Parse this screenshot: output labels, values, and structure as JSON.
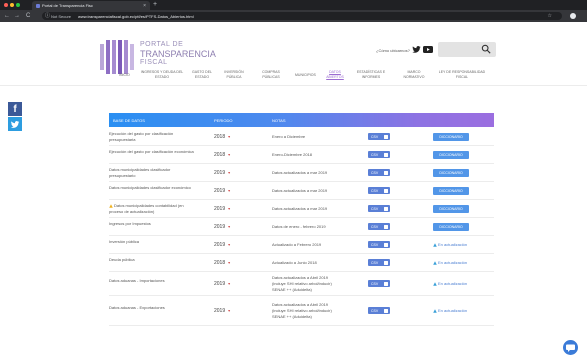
{
  "browser": {
    "tab_title": "Portal de Transparencia Fisc",
    "tab_close": "×",
    "new_tab": "+",
    "back": "←",
    "forward": "→",
    "reload": "C",
    "info": "ⓘ",
    "security": "Not Secure",
    "url": "www.transparenciafiscal.gob.ec/ptf/es/PTFS-Datos_Abiertos.html",
    "star": "☆",
    "dot_colors": [
      "#ff5f57",
      "#febc2e",
      "#28c840"
    ]
  },
  "site": {
    "logo": [
      "PORTAL DE",
      "TRANSPARENCIA",
      "FISCAL"
    ],
    "contact_question": "¿Cómo ubicarnos?",
    "brand_colors": {
      "purple": "#9b6ee0",
      "blue": "#2a8ff2"
    }
  },
  "nav": [
    {
      "label": "INICIO"
    },
    {
      "label": "INGRESOS Y DEUDA DEL ESTADO"
    },
    {
      "label": "GASTO DEL ESTADO"
    },
    {
      "label": "INVERSIÓN PÚBLICA"
    },
    {
      "label": "COMPRAS PÚBLICAS"
    },
    {
      "label": "MUNICIPIOS"
    },
    {
      "label": "DATOS ABIERTOS",
      "active": true
    },
    {
      "label": "ESTADÍSTICAS E INFORMES"
    },
    {
      "label": "MARCO NORMATIVO"
    },
    {
      "label": "LEY DE RESPONSABILIDAD FISCAL"
    }
  ],
  "table": {
    "headers": {
      "name": "BASE DE DATOS",
      "period": "PERIODO",
      "notes": "NOTAS"
    },
    "csv_label": "CSV",
    "dict_label": "DICCIONARIO",
    "update_label": "En actualización",
    "rows": [
      {
        "name": "Ejecución del gasto por clasificación presupuestaria",
        "year": "2018",
        "note": "Enero a Diciembre",
        "action": "dict"
      },
      {
        "name": "Ejecución del gasto por clasificación económica",
        "year": "2018",
        "note": "Enero-Diciembre 2018",
        "action": "dict"
      },
      {
        "name": "Datos municipalidades clasificador presupuestario",
        "year": "2019",
        "note": "Datos actualizados a mar 2019",
        "action": "dict"
      },
      {
        "name": "Datos municipalidades clasificador económico",
        "year": "2019",
        "note": "Datos actualizados a mar 2019",
        "action": "dict"
      },
      {
        "name": "Datos municipalidades contabilidad (en proceso de actualización)",
        "year": "2019",
        "note": "Datos actualizados a mar 2019",
        "action": "dict",
        "warning": true
      },
      {
        "name": "Ingresos por Impuestos",
        "year": "2019",
        "note": "Datos de enero - febrero 2019",
        "action": "dict"
      },
      {
        "name": "Inversión pública",
        "year": "2019",
        "note": "Actualizado a Febrero 2019",
        "action": "update"
      },
      {
        "name": "Deuda pública",
        "year": "2018",
        "note": "Actualizado a Junio 2018",
        "action": "update"
      },
      {
        "name": "Datos aduanas - Importaciones",
        "year": "2019",
        "note": "Datos actualizados a Abril 2019 (incluye SHI relativo arbol/inducir) SENAE ++ (Aduidelta)",
        "action": "update"
      },
      {
        "name": "Datos aduanas - Exportaciones",
        "year": "2019",
        "note": "Datos actualizados a Abril 2019 (incluye SHI relativo arbol/inducir) SENAE ++ (Aduidelta)",
        "action": "update"
      }
    ]
  },
  "icons": [
    "close-icon",
    "search-icon",
    "twitter-icon",
    "youtube-icon",
    "facebook-icon",
    "caret-down-icon",
    "warning-icon",
    "refresh-icon",
    "chat-icon",
    "csv-file-icon"
  ]
}
